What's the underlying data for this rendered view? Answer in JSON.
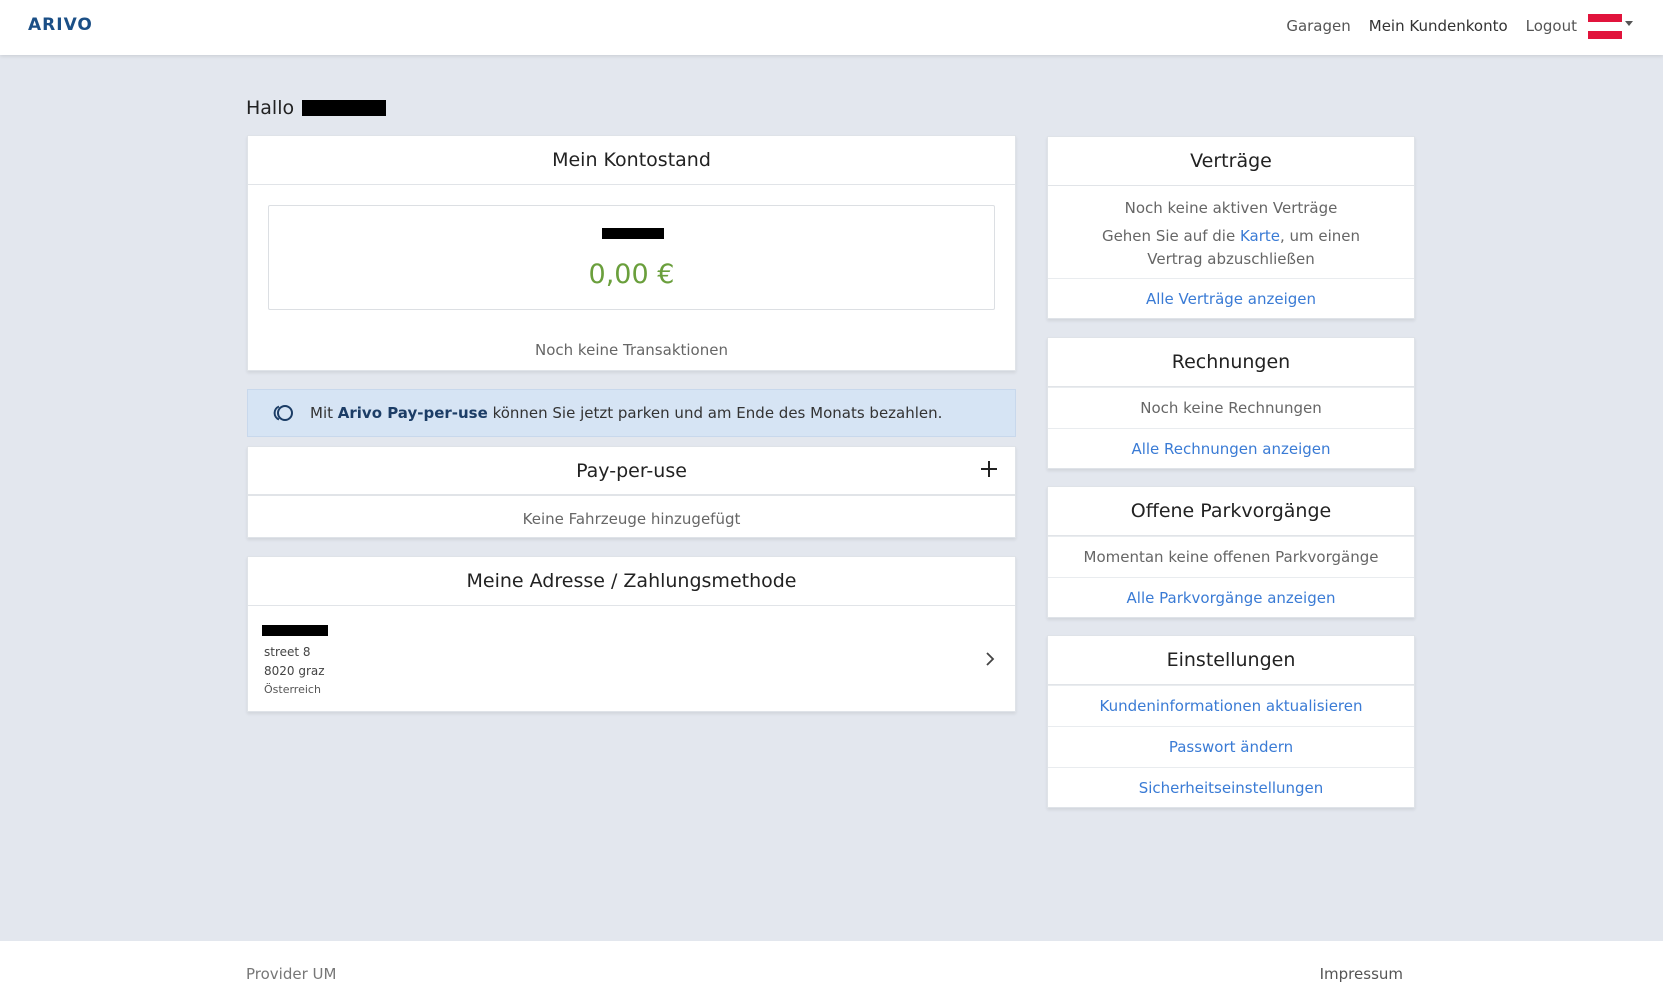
{
  "header": {
    "logo": "ARIVO",
    "nav": [
      "Garagen",
      "Mein Kundenkonto",
      "Logout"
    ]
  },
  "greeting": "Hallo",
  "kontostand": {
    "title": "Mein Kontostand",
    "amount": "0,00 €",
    "transactions": "Noch keine Transaktionen"
  },
  "info": {
    "prefix": "Mit ",
    "brand": "Arivo Pay-per-use",
    "suffix": " können Sie jetzt parken und am Ende des Monats bezahlen."
  },
  "payperuse": {
    "title": "Pay-per-use",
    "add_icon": "plus-icon",
    "empty": "Keine Fahrzeuge hinzugefügt"
  },
  "adresse": {
    "title": "Meine Adresse / Zahlungsmethode",
    "street": "street 8",
    "city": "8020 graz",
    "country": "Österreich"
  },
  "vertraege": {
    "title": "Verträge",
    "empty": "Noch keine aktiven Verträge",
    "hint_before": "Gehen Sie auf die ",
    "hint_link": "Karte",
    "hint_after": ", um einen Vertrag abzuschließen",
    "all": "Alle Verträge anzeigen"
  },
  "rechnungen": {
    "title": "Rechnungen",
    "empty": "Noch keine Rechnungen",
    "all": "Alle Rechnungen anzeigen"
  },
  "parkvorgaenge": {
    "title": "Offene Parkvorgänge",
    "empty": "Momentan keine offenen Parkvorgänge",
    "all": "Alle Parkvorgänge anzeigen"
  },
  "einstellungen": {
    "title": "Einstellungen",
    "items": [
      "Kundeninformationen aktualisieren",
      "Passwort ändern",
      "Sicherheitseinstellungen"
    ]
  },
  "footer": {
    "left": "Provider UM",
    "right": "Impressum"
  },
  "colors": {
    "brand": "#1b4f86",
    "link": "#3a7bd5",
    "balance": "#6a9f3c",
    "info_bg": "#d6e4f4",
    "page_bg": "#e3e7ee"
  }
}
